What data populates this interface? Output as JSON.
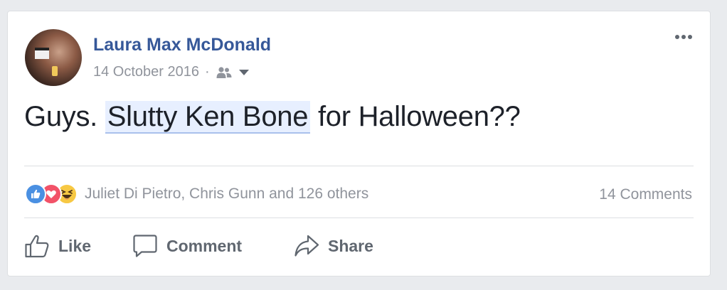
{
  "post": {
    "author": "Laura Max McDonald",
    "date": "14 October 2016",
    "separator": "·",
    "audience_icon": "friends-icon",
    "text_before": "Guys. ",
    "text_highlight": "Slutty Ken Bone",
    "text_after": " for Halloween??"
  },
  "reactions": {
    "icons": [
      "like-reaction-icon",
      "love-reaction-icon",
      "haha-reaction-icon"
    ],
    "names": "Juliet Di Pietro, Chris Gunn and 126 others",
    "comments": "14 Comments"
  },
  "actions": {
    "like_label": "Like",
    "comment_label": "Comment",
    "share_label": "Share"
  },
  "colors": {
    "author": "#365899",
    "meta": "#90949c",
    "highlight_bg": "#e7efff",
    "action_text": "#606770"
  }
}
